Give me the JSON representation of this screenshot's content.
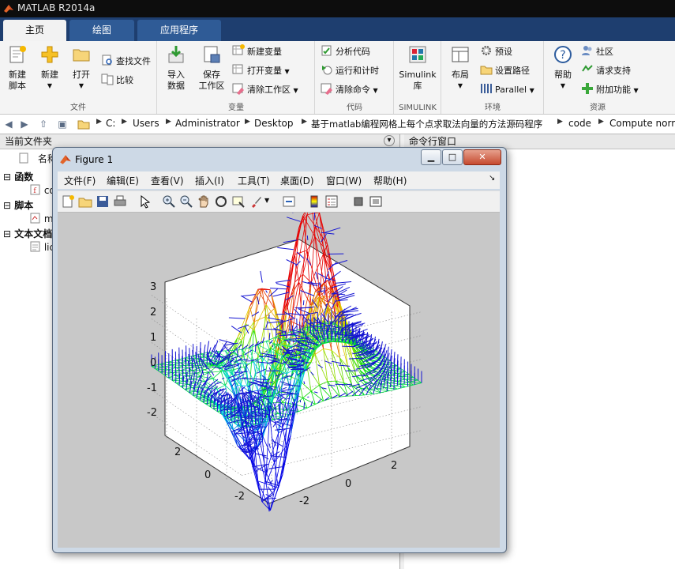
{
  "app": {
    "title": "MATLAB R2014a",
    "tabs": [
      {
        "label": "主页"
      },
      {
        "label": "绘图"
      },
      {
        "label": "应用程序"
      }
    ]
  },
  "ribbon": {
    "file": {
      "label": "文件",
      "new_script": "新建\n脚本",
      "new": "新建",
      "open": "打开",
      "find_files": "查找文件",
      "compare": "比较"
    },
    "variable": {
      "label": "变量",
      "import_data": "导入\n数据",
      "save_workspace": "保存\n工作区",
      "new_variable": "新建变量",
      "open_variable": "打开变量",
      "clear_workspace": "清除工作区"
    },
    "code": {
      "label": "代码",
      "analyze_code": "分析代码",
      "run_and_time": "运行和计时",
      "clear_commands": "清除命令"
    },
    "simulink": {
      "label": "SIMULINK",
      "library": "Simulink\n库"
    },
    "environment": {
      "label": "环境",
      "layout": "布局",
      "preferences": "预设",
      "set_path": "设置路径",
      "parallel": "Parallel"
    },
    "resources": {
      "label": "资源",
      "help": "帮助",
      "community": "社区",
      "request_support": "请求支持",
      "addons": "附加功能"
    }
  },
  "address_bar": {
    "crumbs": [
      "C:",
      "Users",
      "Administrator",
      "Desktop",
      "基于matlab编程网格上每个点求取法向量的方法源码程序",
      "code",
      "Compute norm"
    ]
  },
  "current_folder": {
    "header": "当前文件夹",
    "column_name": "名称",
    "groups": [
      {
        "label": "函数",
        "item": "co"
      },
      {
        "label": "脚本",
        "item": "m"
      },
      {
        "label": "文本文档",
        "item": "lic"
      }
    ]
  },
  "command_window": {
    "header": "命令行窗口"
  },
  "figure": {
    "title": "Figure 1",
    "menus": [
      "文件(F)",
      "编辑(E)",
      "查看(V)",
      "插入(I)",
      "工具(T)",
      "桌面(D)",
      "窗口(W)",
      "帮助(H)"
    ],
    "z_ticks": [
      "3",
      "2",
      "1",
      "0",
      "-1",
      "-2"
    ],
    "y_ticks": [
      "2",
      "0",
      "-2"
    ],
    "x_ticks": [
      "-2",
      "0",
      "2"
    ]
  },
  "colors": {
    "tab_strip": "#1e3e6f",
    "ribbon_bg": "#f4f4f4",
    "figure_bg": "#c8c8c8"
  }
}
